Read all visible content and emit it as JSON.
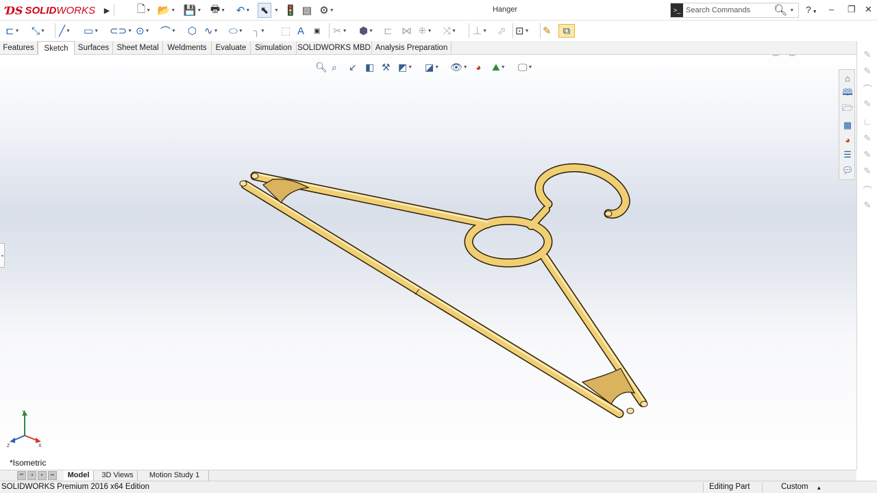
{
  "app": {
    "name_bold": "SOLID",
    "name_light": "WORKS",
    "brand_color": "#d0021b"
  },
  "document": {
    "title": "Hanger"
  },
  "search": {
    "placeholder": "Search Commands"
  },
  "help": {
    "label": "?"
  },
  "window_controls": {
    "minimize": "–",
    "restore": "❐",
    "close": "✕"
  },
  "quick_access": {
    "icons": [
      "expand-arrow-icon",
      "new-document-icon",
      "open-icon",
      "save-icon",
      "print-icon",
      "undo-icon",
      "select-icon",
      "rebuild-icon",
      "file-properties-icon",
      "options-icon"
    ]
  },
  "command_manager": {
    "icons": [
      "sketch-line-icon",
      "smart-dimension-icon",
      "line-icon",
      "rectangle-icon",
      "slot-icon",
      "circle-icon",
      "arc-icon",
      "polygon-icon",
      "spline-icon",
      "ellipse-icon",
      "fillet-icon",
      "plane-icon",
      "text-icon",
      "point-icon",
      "mirror-icon",
      "trim-icon",
      "convert-icon",
      "offset-icon",
      "linear-pattern-icon",
      "move-icon",
      "display-relations-icon",
      "repair-sketch-icon",
      "quick-snaps-icon",
      "rapid-sketch-icon",
      "instant2d-icon"
    ]
  },
  "tabs": [
    {
      "label": "Features"
    },
    {
      "label": "Sketch"
    },
    {
      "label": "Surfaces"
    },
    {
      "label": "Sheet Metal"
    },
    {
      "label": "Weldments"
    },
    {
      "label": "Evaluate"
    },
    {
      "label": "Simulation"
    },
    {
      "label": "SOLIDWORKS MBD"
    },
    {
      "label": "Analysis Preparation"
    }
  ],
  "active_tab": "Sketch",
  "heads_up": {
    "icons": [
      "zoom-to-fit-icon",
      "zoom-to-area-icon",
      "previous-view-icon",
      "section-view-icon",
      "dynamic-annotation-icon",
      "view-orientation-icon",
      "display-style-icon",
      "hide-show-icon",
      "edit-appearance-icon",
      "apply-scene-icon",
      "view-settings-icon"
    ]
  },
  "graphics": {
    "view_name": "*Isometric",
    "part_color": "#f0cf74",
    "part_edge": "#2a1d06",
    "triad": {
      "x": "X",
      "y": "Y",
      "z": "Z"
    }
  },
  "task_pane": {
    "icons": [
      "home-icon",
      "design-library-icon",
      "file-explorer-icon",
      "view-palette-icon",
      "appearances-icon",
      "custom-properties-icon",
      "forum-icon"
    ]
  },
  "bottom_tabs": [
    {
      "label": "Model"
    },
    {
      "label": "3D Views"
    },
    {
      "label": "Motion Study 1"
    }
  ],
  "active_bottom_tab": "Model",
  "status_bar": {
    "edition": "SOLIDWORKS Premium 2016 x64 Edition",
    "mode": "Editing Part",
    "units": "Custom",
    "units_arrow": "▴"
  }
}
